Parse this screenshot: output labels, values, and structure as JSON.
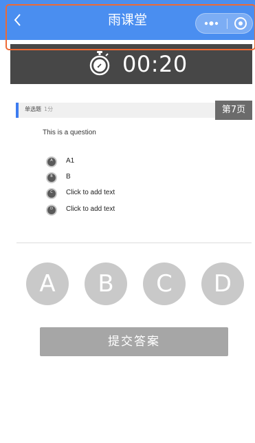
{
  "navbar": {
    "title": "雨课堂",
    "back_icon": "chevron-left-icon",
    "more_icon": "more-dots-icon",
    "close_icon": "target-circle-icon",
    "color": "#4a8ef0"
  },
  "timer": {
    "icon": "stopwatch-icon",
    "value": "00:20",
    "highlight_color": "#ed6a35"
  },
  "question": {
    "type_label": "单选题",
    "score_label": "1分",
    "page_label": "第7页",
    "text": "This is a question",
    "options": [
      {
        "letter": "A",
        "text": "A1"
      },
      {
        "letter": "B",
        "text": "B"
      },
      {
        "letter": "C",
        "text": "Click to add text"
      },
      {
        "letter": "D",
        "text": "Click to add text"
      }
    ]
  },
  "answers": [
    "A",
    "B",
    "C",
    "D"
  ],
  "submit_label": "提交答案"
}
